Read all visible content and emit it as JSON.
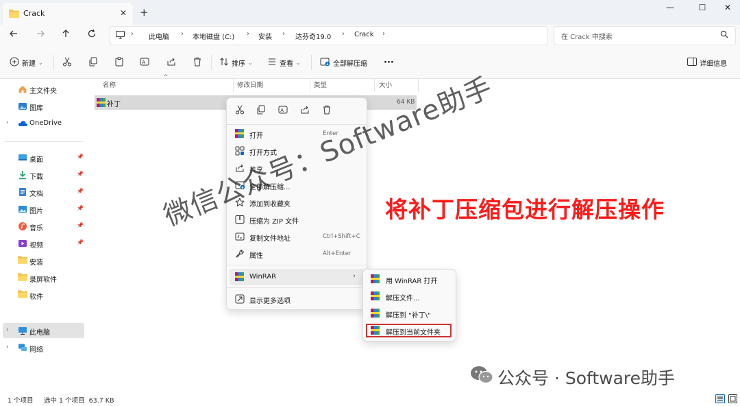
{
  "window": {
    "tab_title": "Crack",
    "tab_close": "✕",
    "new_tab": "+",
    "controls": {
      "minimize": "—",
      "maximize": "☐",
      "close": "✕"
    }
  },
  "address": {
    "breadcrumbs": [
      "此电脑",
      "本地磁盘 (C:)",
      "安装",
      "达芬奇19.0",
      "Crack"
    ],
    "search_placeholder": "在 Crack 中搜索"
  },
  "toolbar": {
    "new": "新建",
    "sort": "排序",
    "view": "查看",
    "extract_all": "全部解压缩",
    "more": "···",
    "details": "详细信息"
  },
  "sidebar": {
    "top": [
      {
        "label": "主文件夹"
      },
      {
        "label": "图库"
      },
      {
        "label": "OneDrive"
      }
    ],
    "quick": [
      {
        "label": "桌面"
      },
      {
        "label": "下载"
      },
      {
        "label": "文档"
      },
      {
        "label": "图片"
      },
      {
        "label": "音乐"
      },
      {
        "label": "视频"
      },
      {
        "label": "安装"
      },
      {
        "label": "录屏软件"
      },
      {
        "label": "软件"
      }
    ],
    "bottom": [
      {
        "label": "此电脑"
      },
      {
        "label": "网络"
      }
    ]
  },
  "columns": {
    "name": "名称",
    "modified": "修改日期",
    "type": "类型",
    "size": "大小"
  },
  "files": [
    {
      "name": "补丁",
      "size": "64 KB"
    }
  ],
  "context_menu": {
    "items": [
      {
        "label": "打开",
        "shortcut": "Enter"
      },
      {
        "label": "打开方式",
        "shortcut": ""
      },
      {
        "label": "共享",
        "shortcut": ""
      },
      {
        "label": "全部解压缩...",
        "shortcut": ""
      },
      {
        "label": "添加到收藏夹",
        "shortcut": ""
      },
      {
        "label": "压缩为 ZIP 文件",
        "shortcut": ""
      },
      {
        "label": "复制文件地址",
        "shortcut": "Ctrl+Shift+C"
      },
      {
        "label": "属性",
        "shortcut": "Alt+Enter"
      }
    ],
    "winrar": "WinRAR",
    "more_options": "显示更多选项"
  },
  "submenu": {
    "items": [
      {
        "label": "用 WinRAR 打开"
      },
      {
        "label": "解压文件..."
      },
      {
        "label": "解压到 \"补丁\\\""
      },
      {
        "label": "解压到当前文件夹"
      }
    ]
  },
  "status": {
    "count": "1 个项目",
    "selected": "选中 1 个项目  63.7 KB"
  },
  "overlay": {
    "annotation": "将补丁压缩包进行解压操作",
    "watermark_diag": "微信公众号：Software助手",
    "watermark_bottom": "公众号 · Software助手"
  },
  "colors": {
    "accent": "#0067c0",
    "annotation": "#ff1a1a",
    "folder": "#f2c14e",
    "highlight": "#d03333"
  }
}
